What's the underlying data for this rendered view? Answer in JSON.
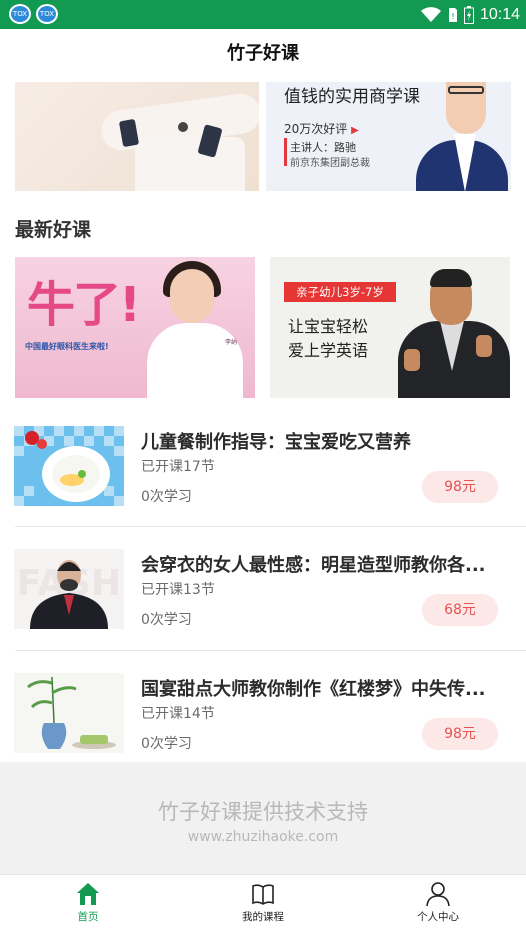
{
  "status_bar": {
    "time": "10:14",
    "notifications": [
      "TOX",
      "TOX"
    ]
  },
  "header": {
    "title": "竹子好课"
  },
  "top_banner": {
    "subtitle": "值钱的实用商学课",
    "rating": "20万次好评",
    "lecturer": "主讲人：路驰",
    "organization": "前京东集团副总裁"
  },
  "section": {
    "title": "最新好课"
  },
  "promos": [
    {
      "headline": "牛了!",
      "slogan": "中国最好眼科医生来啦!",
      "tag": "李纳"
    },
    {
      "label": "亲子幼儿3岁-7岁",
      "line1": "让宝宝轻松",
      "line2": "爱上学英语"
    }
  ],
  "courses": [
    {
      "title": "儿童餐制作指导：宝宝爱吃又营养",
      "lessons": "已开课17节",
      "learners": "0次学习",
      "price": "98元"
    },
    {
      "title": "会穿衣的女人最性感：明星造型师教你各...",
      "lessons": "已开课13节",
      "learners": "0次学习",
      "price": "68元"
    },
    {
      "title": "国宴甜点大师教你制作《红楼梦》中失传...",
      "lessons": "已开课14节",
      "learners": "0次学习",
      "price": "98元"
    }
  ],
  "footer": {
    "support": "竹子好课提供技术支持",
    "url": "www.zhuzihaoke.com"
  },
  "nav": [
    {
      "label": "首页",
      "icon": "home-icon",
      "active": true
    },
    {
      "label": "我的课程",
      "icon": "book-icon",
      "active": false
    },
    {
      "label": "个人中心",
      "icon": "person-icon",
      "active": false
    }
  ],
  "colors": {
    "accent": "#139a52",
    "price_text": "#e55353",
    "price_bg": "#fde8e8"
  }
}
